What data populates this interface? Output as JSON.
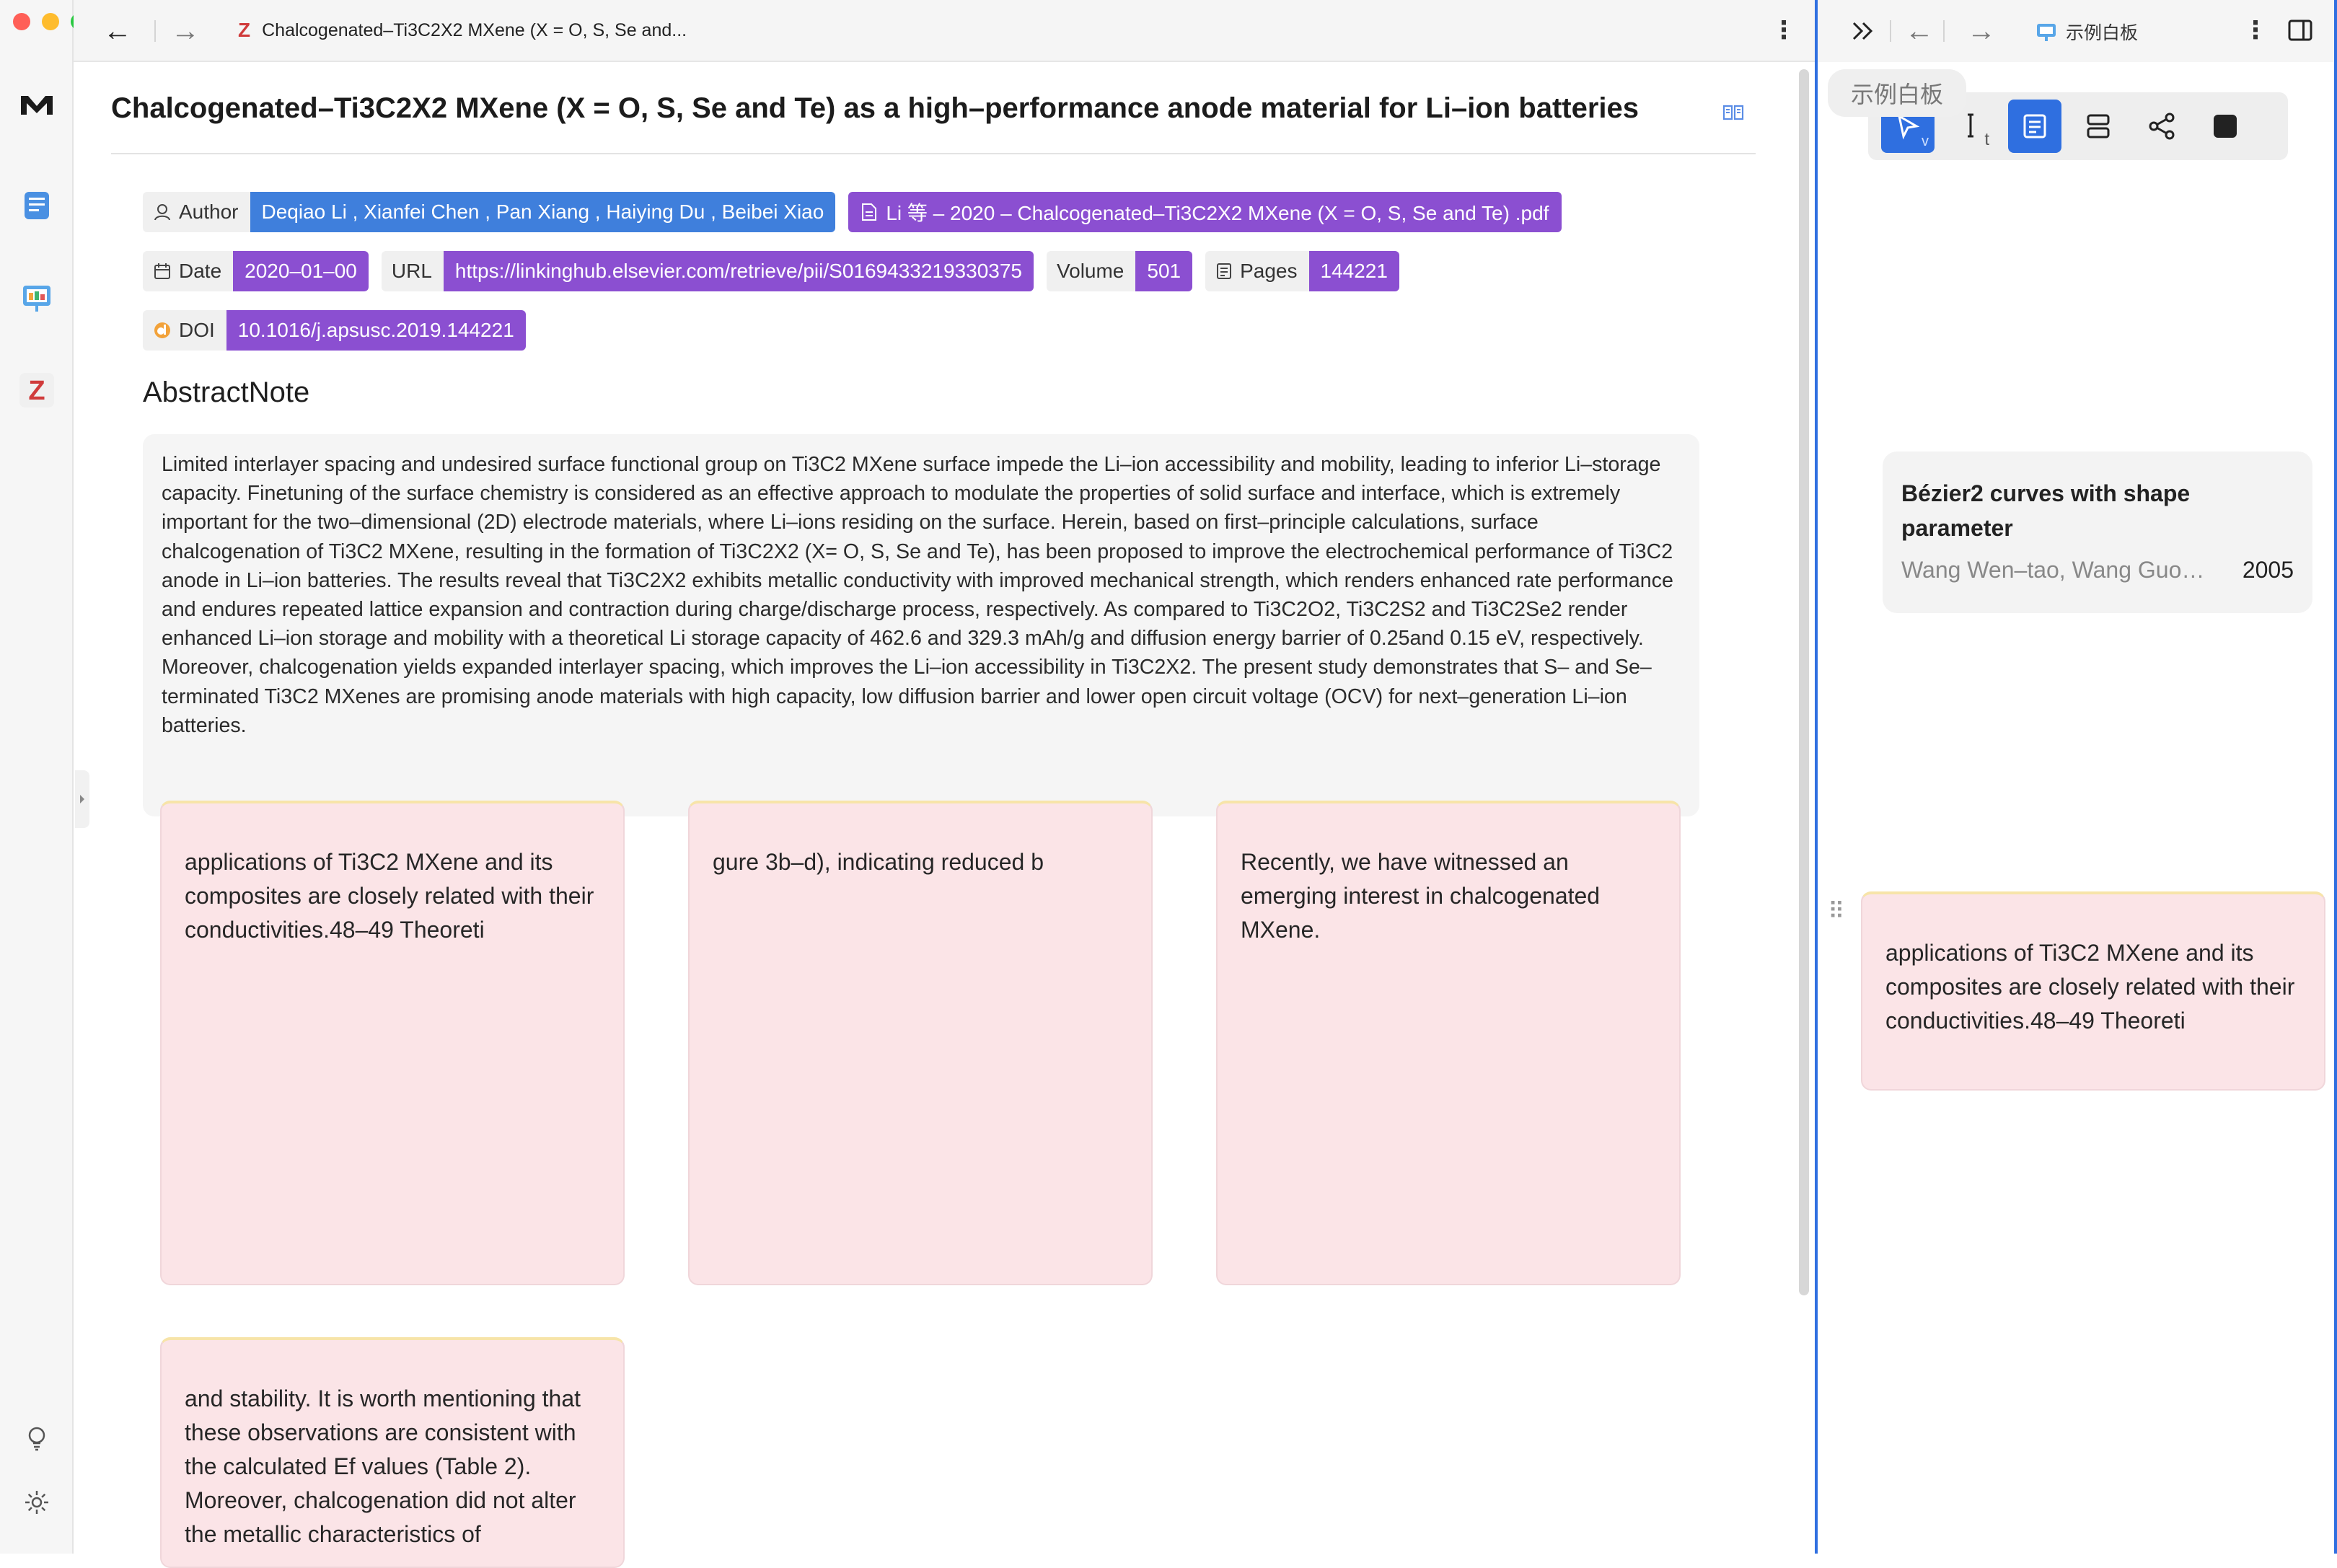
{
  "window": {
    "tab_title": "Chalcogenated–Ti3C2X2 MXene (X = O, S, Se and...",
    "tab_icon": "Z",
    "back_glyph": "←",
    "forward_glyph": "→",
    "more_glyph": "⋮"
  },
  "doc": {
    "title": "Chalcogenated–Ti3C2X2 MXene (X = O, S, Se and Te) as a high–performance anode material for Li–ion batteries",
    "author_key": "Author",
    "author_val": "Deqiao Li , Xianfei Chen , Pan Xiang , Haiying Du , Beibei Xiao",
    "pdf_val": "Li 等 – 2020 – Chalcogenated–Ti3C2X2 MXene (X = O, S, Se and Te) .pdf",
    "date_key": "Date",
    "date_val": "2020–01–00",
    "url_key": "URL",
    "url_val": "https://linkinghub.elsevier.com/retrieve/pii/S0169433219330375",
    "volume_key": "Volume",
    "volume_val": "501",
    "pages_key": "Pages",
    "pages_val": "144221",
    "doi_key": "DOI",
    "doi_val": "10.1016/j.apsusc.2019.144221",
    "abstract_heading": "AbstractNote",
    "abstract": "Limited interlayer spacing and undesired surface functional group on Ti3C2 MXene surface impede the Li–ion accessibility and mobility, leading to inferior Li–storage capacity. Finetuning of the surface chemistry is considered as an effective approach to modulate the properties of solid surface and interface, which is extremely important for the two–dimensional (2D) electrode materials, where Li–ions residing on the surface. Herein, based on first–principle calculations, surface chalcogenation of Ti3C2 MXene, resulting in the formation of Ti3C2X2 (X= O, S, Se and Te), has been proposed to improve the electrochemical performance of Ti3C2 anode in Li–ion batteries. The results reveal that Ti3C2X2 exhibits metallic conductivity with improved mechanical strength, which renders enhanced rate performance and endures repeated lattice expansion and contraction during charge/discharge process, respectively. As compared to Ti3C2O2, Ti3C2S2 and Ti3C2Se2 render enhanced Li–ion storage and mobility with a theoretical Li storage capacity of 462.6 and 329.3 mAh/g and diffusion energy barrier of 0.25and 0.15 eV, respectively. Moreover, chalcogenation yields expanded interlayer spacing, which improves the Li–ion accessibility in Ti3C2X2. The present study demonstrates that S– and Se– terminated Ti3C2 MXenes are promising anode materials with high capacity, low diffusion barrier and lower open circuit voltage (OCV) for next–generation Li–ion batteries."
  },
  "notes": [
    "applications of Ti3C2 MXene and its composites are closely related with their conductivities.48–49 Theoreti",
    "gure 3b–d), indicating reduced b",
    "Recently, we have witnessed an emerging interest in chalcogenated MXene.",
    "and stability. It is worth mentioning that these observations are consistent with the calculated Ef values (Table 2). Moreover, chalcogenation did not alter the metallic characteristics of"
  ],
  "right_panel": {
    "tab_title": "示例白板",
    "tooltip": "示例白板",
    "toolbar_hints": [
      "v",
      "t"
    ],
    "ref_title": "Bézier2 curves with shape parameter",
    "ref_authors": "Wang Wen–tao, Wang Guo…",
    "ref_year": "2005",
    "note": "applications of Ti3C2 MXene and its composites are closely related with their conductivities.48–49 Theoreti",
    "drag_glyph": "⠿"
  },
  "colors": {
    "accent_purple": "#8b4fd1",
    "focus_blue": "#2f6fe0",
    "note_pink": "#fbe4e7",
    "zotero_red": "#d03b3b"
  }
}
